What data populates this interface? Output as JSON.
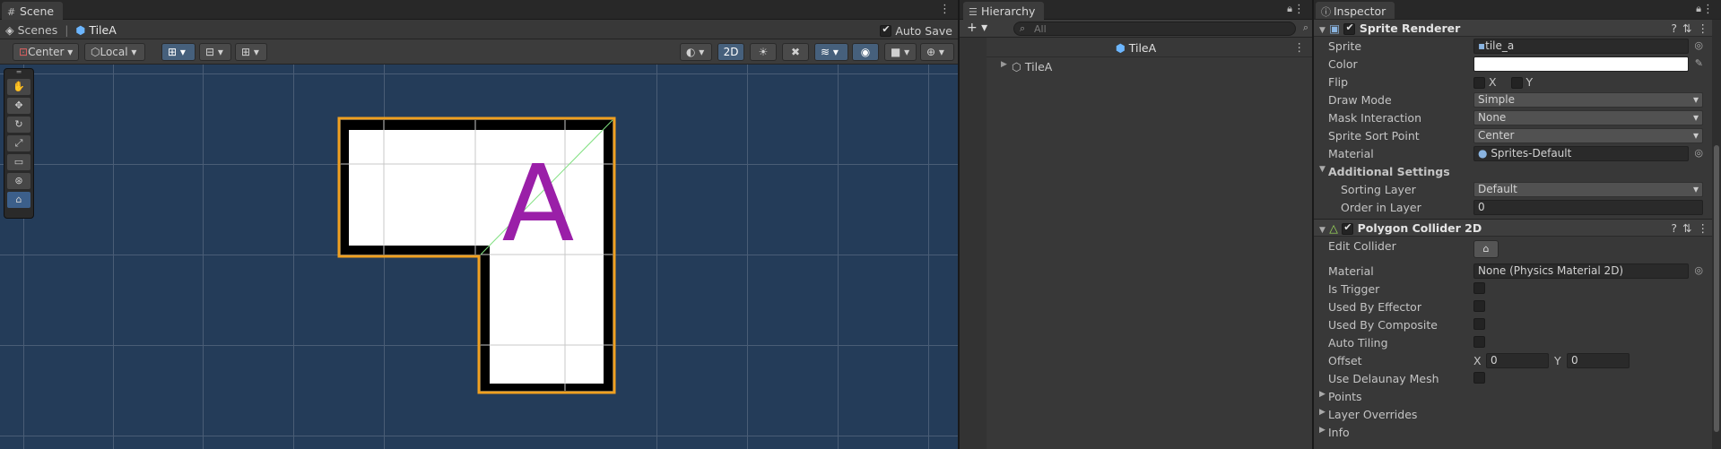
{
  "scene": {
    "tab": "Scene",
    "breadcrumb": {
      "root": "Scenes",
      "separator": "|",
      "current": "TileA"
    },
    "autosave_label": "Auto Save",
    "autosave_checked": true,
    "toolbar": {
      "pivot": "Center",
      "space": "Local",
      "mode_2d": "2D"
    },
    "tools": [
      "hand-tool",
      "move-tool",
      "rotate-tool",
      "scale-tool",
      "rect-tool",
      "transform-tool",
      "edit-collider-tool"
    ],
    "sprite_letter": "A"
  },
  "hierarchy": {
    "tab": "Hierarchy",
    "search_placeholder": "All",
    "header": "TileA",
    "rows": [
      {
        "label": "TileA"
      }
    ]
  },
  "inspector": {
    "tab": "Inspector",
    "sprite_renderer": {
      "title": "Sprite Renderer",
      "sprite_label": "Sprite",
      "sprite_value": "tile_a",
      "color_label": "Color",
      "flip_label": "Flip",
      "flip_x": "X",
      "flip_y": "Y",
      "draw_mode_label": "Draw Mode",
      "draw_mode_value": "Simple",
      "mask_label": "Mask Interaction",
      "mask_value": "None",
      "sort_point_label": "Sprite Sort Point",
      "sort_point_value": "Center",
      "material_label": "Material",
      "material_value": "Sprites-Default",
      "additional_label": "Additional Settings",
      "sorting_layer_label": "Sorting Layer",
      "sorting_layer_value": "Default",
      "order_label": "Order in Layer",
      "order_value": "0"
    },
    "polygon_collider": {
      "title": "Polygon Collider 2D",
      "edit_label": "Edit Collider",
      "material_label": "Material",
      "material_value": "None (Physics Material 2D)",
      "trigger_label": "Is Trigger",
      "effector_label": "Used By Effector",
      "composite_label": "Used By Composite",
      "tiling_label": "Auto Tiling",
      "offset_label": "Offset",
      "offset_x_label": "X",
      "offset_x": "0",
      "offset_y_label": "Y",
      "offset_y": "0",
      "delaunay_label": "Use Delaunay Mesh",
      "points_label": "Points",
      "overrides_label": "Layer Overrides",
      "info_label": "Info"
    }
  },
  "colors": {
    "scene_bg": "#243c59",
    "selection_outline": "#f0a020",
    "collider_line": "#7fe07f",
    "letter": "#9a1fa8"
  }
}
